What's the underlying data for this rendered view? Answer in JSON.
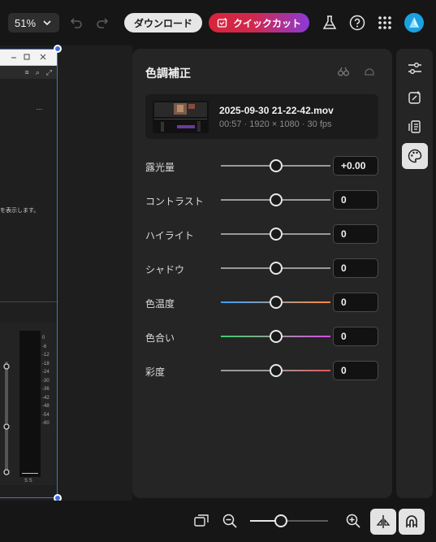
{
  "toolbar": {
    "zoom_value": "51%",
    "download_label": "ダウンロード",
    "quickcut_label": "クイックカット"
  },
  "preview": {
    "dots": "...",
    "snippet_text": "を表示します。",
    "meter_scale": [
      "0",
      "-6",
      "-12",
      "-18",
      "-24",
      "-30",
      "-36",
      "-42",
      "-48",
      "-54",
      "-60"
    ],
    "meter_channels": "S  S"
  },
  "panel": {
    "title": "色調補正",
    "file": {
      "name": "2025-09-30 21-22-42.mov",
      "meta": "00:57 · 1920 × 1080 · 30 fps"
    },
    "adjustments": [
      {
        "label": "露光量",
        "value": "+0.00",
        "level": 0.5,
        "track": "neutral"
      },
      {
        "label": "コントラスト",
        "value": "0",
        "level": 0.5,
        "track": "neutral"
      },
      {
        "label": "ハイライト",
        "value": "0",
        "level": 0.5,
        "track": "neutral"
      },
      {
        "label": "シャドウ",
        "value": "0",
        "level": 0.5,
        "track": "neutral"
      },
      {
        "label": "色温度",
        "value": "0",
        "level": 0.5,
        "track": "temperature"
      },
      {
        "label": "色合い",
        "value": "0",
        "level": 0.5,
        "track": "tint"
      },
      {
        "label": "彩度",
        "value": "0",
        "level": 0.5,
        "track": "saturation"
      }
    ]
  },
  "zoom_slider": {
    "level": 0.4
  },
  "colors": {
    "accent": "#3f6fe6",
    "quickcut_start": "#d8243a",
    "quickcut_end": "#8a3ad6",
    "avatar": "#1ba1e2",
    "temperature_gradient": [
      "#3aa0ff",
      "#9a9a9a",
      "#ff8a3a"
    ],
    "tint_gradient": [
      "#3ad06a",
      "#9a9a9a",
      "#d84ae6"
    ],
    "saturation_gradient": [
      "#9a9a9a",
      "#9a9a9a",
      "#e05a5a"
    ]
  },
  "icons": {
    "top": [
      "chevron-down-icon",
      "undo-icon",
      "redo-icon",
      "flask-icon",
      "help-icon",
      "apps-grid-icon"
    ],
    "side": [
      "adjust-sliders-icon",
      "magic-edit-icon",
      "speed-icon",
      "color-palette-icon"
    ],
    "bottom": [
      "fit-screen-icon",
      "zoom-out-icon",
      "zoom-in-icon",
      "split-icon",
      "magnet-icon"
    ]
  }
}
